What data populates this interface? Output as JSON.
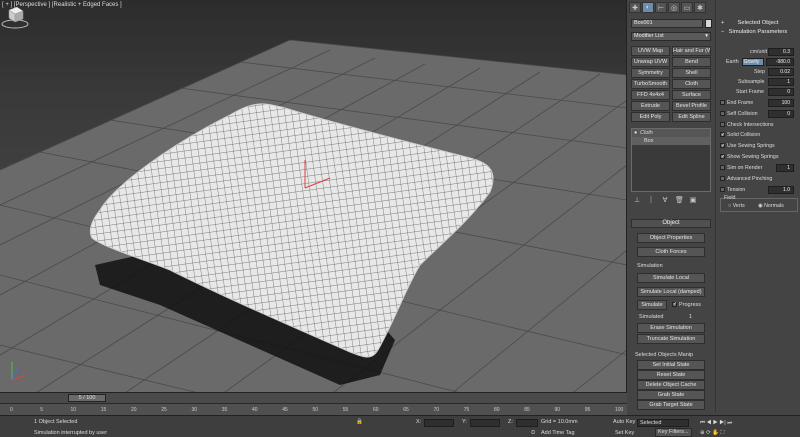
{
  "viewport": {
    "label": "[ + ] [Perspective ] [Realistic + Edged Faces ]"
  },
  "command_panel": {
    "object_name": "Box001",
    "modifier_list": "Modifier List",
    "modifier_buttons": [
      "UVW Map",
      "Hair and Fur (WS",
      "Unwrap UVW",
      "Bend",
      "Symmetry",
      "Shell",
      "TurboSmooth",
      "Cloth",
      "FFD 4x4x4",
      "Surface",
      "Extrude",
      "Bevel Profile",
      "Edit Poly",
      "Edit Spline"
    ],
    "stack": [
      "Cloth",
      "Box"
    ],
    "object_rollout": {
      "title": "Object",
      "object_properties": "Object Properties",
      "cloth_forces": "Cloth Forces",
      "simulation_label": "Simulation",
      "simulate_local": "Simulate Local",
      "simulate_local_damped": "Simulate Local (damped)",
      "simulate": "Simulate",
      "progress": "Progress",
      "simulated_label": "Simulated",
      "simulated_value": "1",
      "erase_simulation": "Erase Simulation",
      "truncate_simulation": "Truncate Simulation"
    },
    "selected_objects_manip": {
      "title": "Selected Objects Manip",
      "set_initial_state": "Set Initial State",
      "reset_state": "Reset State",
      "delete_object_cache": "Delete Object Cache",
      "grab_state": "Grab State",
      "grab_target_state": "Grab Target State"
    }
  },
  "params": {
    "selected_object": "Selected Object",
    "simulation_parameters": "Simulation Parameters",
    "units_label": "cm/unit",
    "units_value": "0.3",
    "earth_label": "Earth",
    "gravity_label": "Gravity",
    "gravity_value": "-980.0",
    "step_label": "Step",
    "step_value": "0.02",
    "subsample_label": "Subsample",
    "subsample_value": "1",
    "start_frame_label": "Start Frame",
    "start_frame_value": "0",
    "end_frame_label": "End Frame",
    "end_frame_value": "100",
    "self_collision_label": "Self Collision",
    "self_collision_value": "0",
    "check_intersections": "Check Intersections",
    "solid_collision": "Solid Collision",
    "use_sewing_springs": "Use Sewing Springs",
    "show_sewing_springs": "Show Sewing Springs",
    "sim_on_render_label": "Sim on Render",
    "sim_on_render_value": "1",
    "advanced_pinching": "Advanced Pinching",
    "tension_label": "Tension",
    "tension_value": "1.0",
    "field_label": "Field",
    "verts": "Verts",
    "normals": "Normals"
  },
  "timeline": {
    "slider": "5 / 100",
    "ticks": [
      "0",
      "5",
      "10",
      "15",
      "20",
      "25",
      "30",
      "35",
      "40",
      "45",
      "50",
      "55",
      "60",
      "65",
      "70",
      "75",
      "80",
      "85",
      "90",
      "95",
      "100"
    ]
  },
  "status": {
    "objects_selected": "1 Object Selected",
    "prompt": "Simulation interrupted by user",
    "x_label": "X:",
    "y_label": "Y:",
    "z_label": "Z:",
    "grid": "Grid = 10.0mm",
    "add_time_tag": "Add Time Tag",
    "auto_key": "Auto Key",
    "selected": "Selected",
    "set_key": "Set Key",
    "key_filters": "Key Filters..."
  }
}
